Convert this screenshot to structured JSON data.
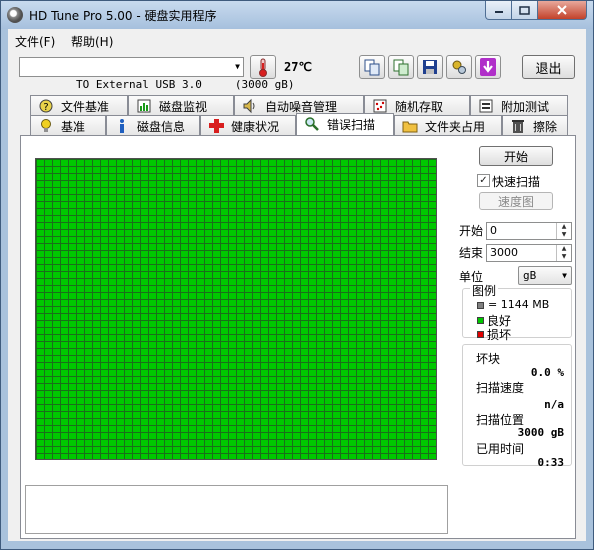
{
  "window": {
    "title": "HD Tune Pro 5.00 - 硬盘实用程序"
  },
  "menu": {
    "file": "文件(F)",
    "help": "帮助(H)"
  },
  "toolbar": {
    "drive": "TO External USB 3.0     (3000 gB)",
    "temperature": "27℃",
    "exit_label": "退出"
  },
  "tabs_top": [
    {
      "label": "文件基准"
    },
    {
      "label": "磁盘监视"
    },
    {
      "label": "自动噪音管理"
    },
    {
      "label": "随机存取"
    },
    {
      "label": "附加测试"
    }
  ],
  "tabs_bottom": [
    {
      "label": "基准"
    },
    {
      "label": "磁盘信息"
    },
    {
      "label": "健康状况"
    },
    {
      "label": "错误扫描"
    },
    {
      "label": "文件夹占用"
    },
    {
      "label": "擦除"
    }
  ],
  "scan": {
    "start_button": "开始",
    "quick_scan_label": "快速扫描",
    "quick_scan_checked": true,
    "speed_map_button": "速度图",
    "start_label": "开始",
    "start_value": "0",
    "end_label": "结束",
    "end_value": "3000",
    "unit_label": "单位",
    "unit_value": "gB",
    "block_status": "all good"
  },
  "legend": {
    "title": "图例",
    "block_size": "= 1144 MB",
    "good": "良好",
    "damaged": "损坏",
    "colors": {
      "block": "#808080",
      "good": "#00c800",
      "damaged": "#e00000"
    }
  },
  "stats": {
    "bad_blocks_label": "坏块",
    "bad_blocks_value": "0.0 %",
    "scan_speed_label": "扫描速度",
    "scan_speed_value": "n/a",
    "scan_position_label": "扫描位置",
    "scan_position_value": "3000 gB",
    "elapsed_label": "已用时间",
    "elapsed_value": "0:33"
  }
}
